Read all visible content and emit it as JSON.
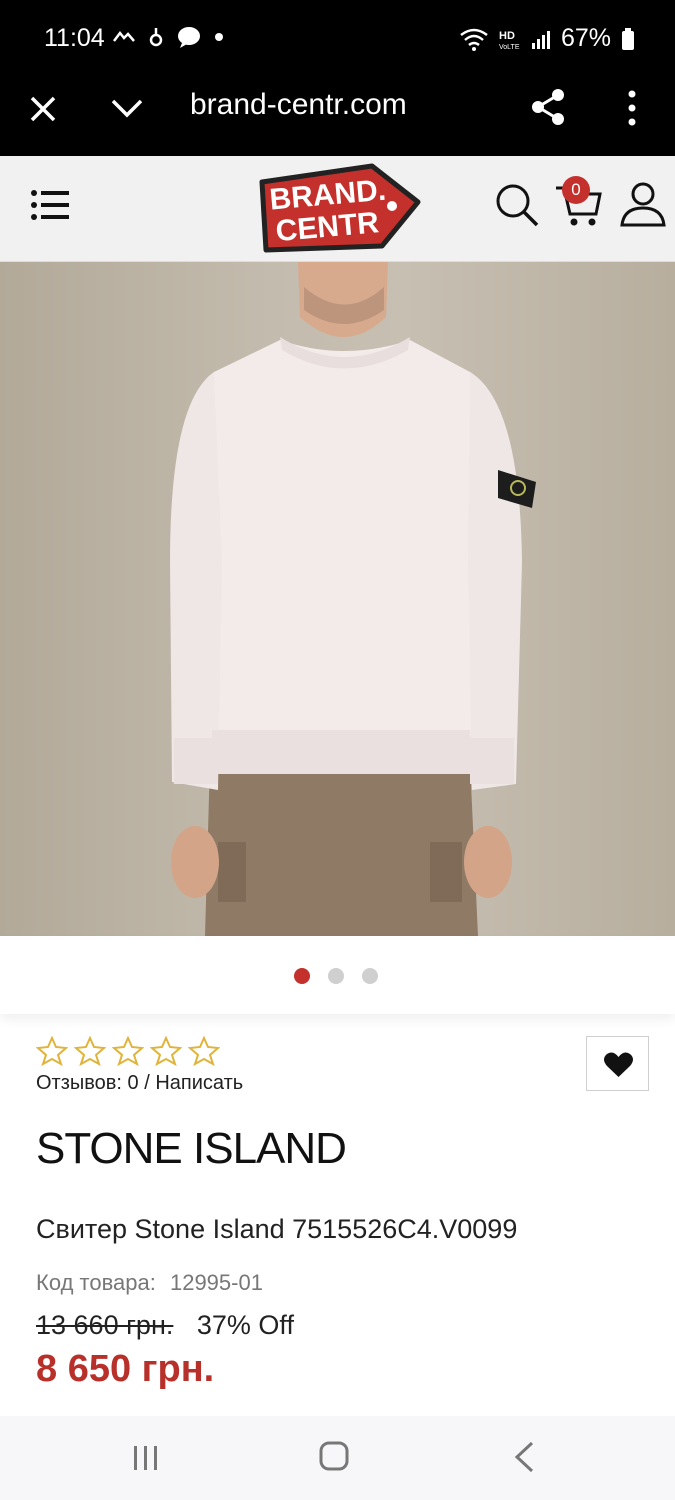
{
  "status_bar": {
    "time": "11:04",
    "battery": "67%"
  },
  "browser": {
    "url": "brand-centr.com"
  },
  "site": {
    "logo_text": "BRAND CENTR",
    "cart_count": "0",
    "accent_color": "#c4302b"
  },
  "gallery": {
    "dots": [
      "active",
      "inactive",
      "inactive"
    ]
  },
  "product": {
    "rating_stars": 0,
    "reviews": "Отзывов: 0 / Написать",
    "brand": "STONE ISLAND",
    "name": "Свитер Stone Island 7515526C4.V0099",
    "sku_label": "Код товара:",
    "sku": "12995-01",
    "old_price": "13 660 грн.",
    "discount": "37% Off",
    "price": "8 650 грн."
  }
}
